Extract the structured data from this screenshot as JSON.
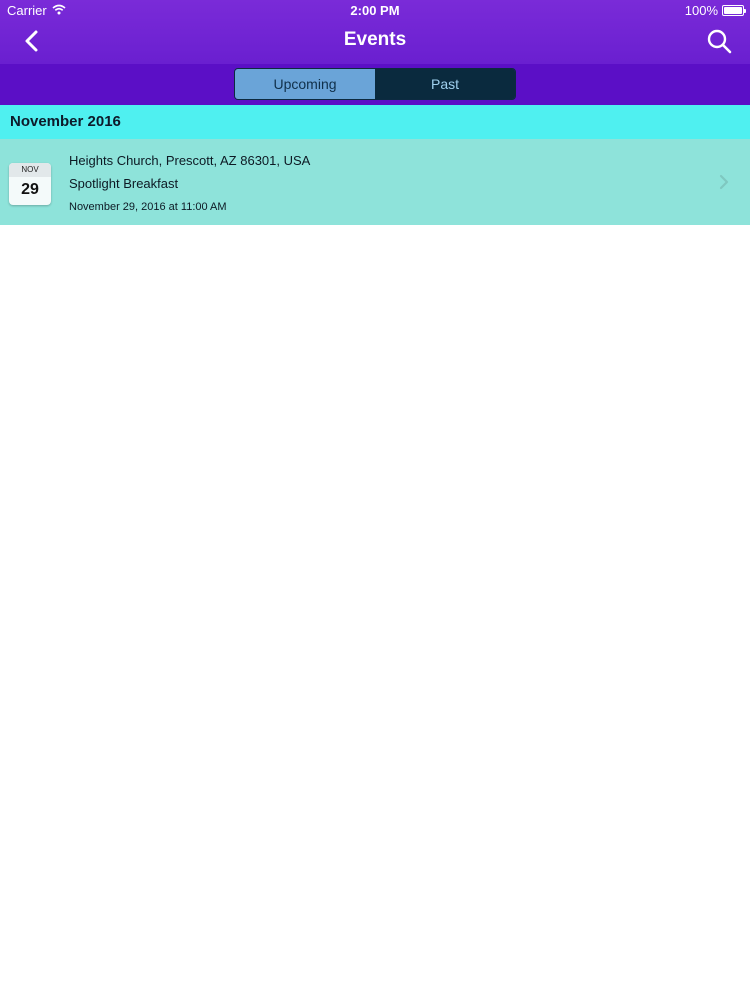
{
  "status_bar": {
    "carrier": "Carrier",
    "time": "2:00 PM",
    "battery": "100%",
    "battery_level": 1.0,
    "wifi_icon": "wifi-icon"
  },
  "nav": {
    "title": "Events",
    "back_icon": "chevron-left-icon",
    "search_icon": "search-icon"
  },
  "tabs": {
    "upcoming": "Upcoming",
    "past": "Past",
    "selected": "Upcoming"
  },
  "section": {
    "header": "November 2016"
  },
  "events": [
    {
      "month": "NOV",
      "day": "29",
      "location": "Heights Church, Prescott, AZ 86301, USA",
      "name": "Spotlight Breakfast",
      "datetime": "November 29, 2016 at 11:00 AM",
      "chevron_icon": "chevron-right-icon"
    }
  ],
  "colors": {
    "nav_bar": "#7a2bd8",
    "segment_bar": "#5b0fc6",
    "section_header": "#4ff0f0",
    "event_row": "#8ee3da",
    "tab_active": "#6aa4d8",
    "tab_inactive": "#0a2a3e"
  }
}
